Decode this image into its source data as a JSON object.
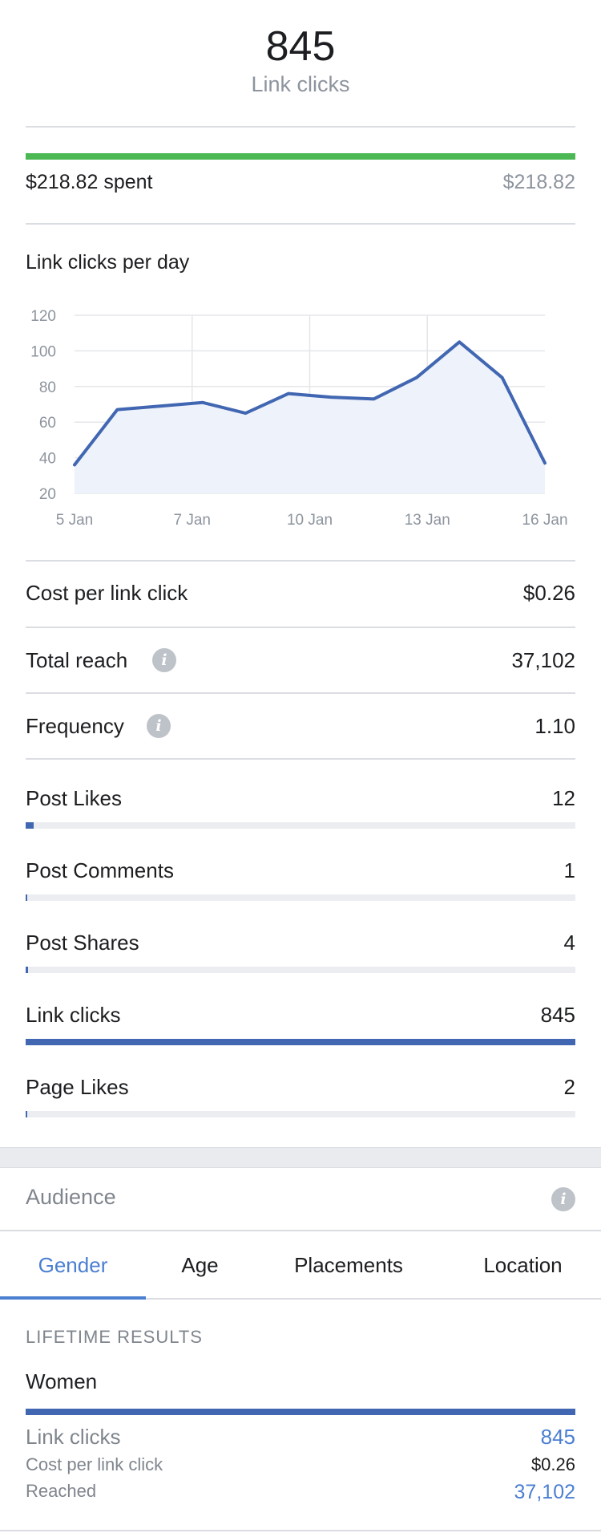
{
  "summary": {
    "value": "845",
    "label": "Link clicks"
  },
  "spend": {
    "label": "$218.82 spent",
    "budget": "$218.82",
    "progress": 1.0,
    "bar_color": "#4bb853"
  },
  "chart_title": "Link clicks per day",
  "chart_data": {
    "type": "area",
    "title": "Link clicks per day",
    "xlabel": "",
    "ylabel": "",
    "x_tick_labels": [
      "5 Jan",
      "7 Jan",
      "10 Jan",
      "13 Jan",
      "16 Jan"
    ],
    "y_tick_labels": [
      "120",
      "100",
      "80",
      "60",
      "40",
      "20"
    ],
    "ylim": [
      20,
      120
    ],
    "xlim": [
      0,
      11
    ],
    "grid": true,
    "series": [
      {
        "color": "#4267b2",
        "x": [
          0,
          1,
          2,
          3,
          4,
          5,
          6,
          7,
          8,
          9,
          10,
          11
        ],
        "y": [
          36,
          67,
          69,
          71,
          65,
          76,
          74,
          73,
          85,
          105,
          85,
          37
        ]
      }
    ]
  },
  "stats": [
    {
      "label": "Cost per link click",
      "value": "$0.26",
      "info": false
    },
    {
      "label": "Total reach",
      "value": "37,102",
      "info": true
    },
    {
      "label": "Frequency",
      "value": "1.10",
      "info": true
    }
  ],
  "engagement": [
    {
      "label": "Post Likes",
      "value": "12",
      "fraction": 0.014
    },
    {
      "label": "Post Comments",
      "value": "1",
      "fraction": 0.0012
    },
    {
      "label": "Post Shares",
      "value": "4",
      "fraction": 0.005
    },
    {
      "label": "Link clicks",
      "value": "845",
      "fraction": 1.0
    },
    {
      "label": "Page Likes",
      "value": "2",
      "fraction": 0.0024
    }
  ],
  "audience": {
    "title": "Audience",
    "tabs": [
      {
        "label": "Gender",
        "active": true
      },
      {
        "label": "Age",
        "active": false
      },
      {
        "label": "Placements",
        "active": false
      },
      {
        "label": "Location",
        "active": false
      }
    ],
    "lifetime_heading": "LIFETIME RESULTS",
    "segment": "Women",
    "segment_fraction": 1.0,
    "results": [
      {
        "label": "Link clicks",
        "value": "845",
        "color": "#4b7fd1"
      },
      {
        "label": "Cost per link click",
        "value": "$0.26",
        "color": "#1c1e21"
      },
      {
        "label": "Reached",
        "value": "37,102",
        "color": "#4b7fd1"
      }
    ]
  },
  "icons": {
    "info": "info-icon"
  },
  "info_glyph": "i"
}
